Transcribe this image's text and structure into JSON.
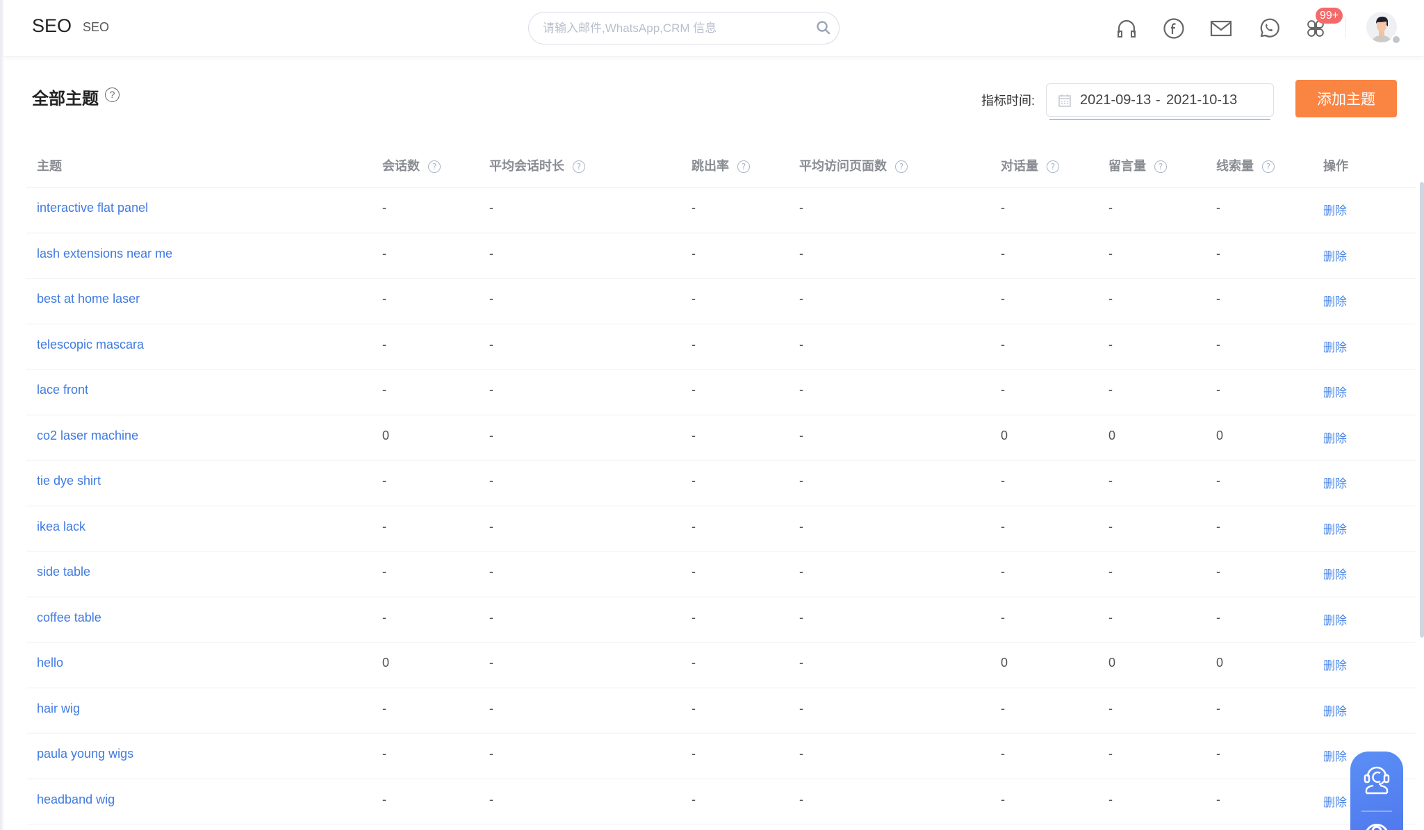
{
  "header": {
    "title": "SEO",
    "subtitle": "SEO",
    "search": {
      "placeholder": "请输入邮件,WhatsApp,CRM 信息",
      "value": ""
    },
    "icons": [
      "headset-icon",
      "facebook-icon",
      "mail-icon",
      "whatsapp-icon",
      "apps-icon"
    ],
    "notification_badge": "99+",
    "colors": {
      "badge": "#f46a6a"
    }
  },
  "page": {
    "title": "全部主题",
    "help_glyph": "?",
    "date_filter": {
      "label": "指标时间:",
      "start": "2021-09-13",
      "separator": "-",
      "end": "2021-10-13"
    },
    "add_button_label": "添加主题",
    "colors": {
      "accent": "#fa8542",
      "link": "#3f7ae0"
    }
  },
  "table": {
    "columns": [
      {
        "label": "主题",
        "help": false
      },
      {
        "label": "会话数",
        "help": true
      },
      {
        "label": "平均会话时长",
        "help": true
      },
      {
        "label": "跳出率",
        "help": true
      },
      {
        "label": "平均访问页面数",
        "help": true
      },
      {
        "label": "对话量",
        "help": true
      },
      {
        "label": "留言量",
        "help": true
      },
      {
        "label": "线索量",
        "help": true
      },
      {
        "label": "操作",
        "help": false
      }
    ],
    "help_glyph": "?",
    "action_label": "删除",
    "rows": [
      {
        "topic": "interactive flat panel",
        "sessions": "-",
        "avg_duration": "-",
        "bounce_rate": "-",
        "avg_pages": "-",
        "conversations": "-",
        "messages": "-",
        "leads": "-"
      },
      {
        "topic": "lash extensions near me",
        "sessions": "-",
        "avg_duration": "-",
        "bounce_rate": "-",
        "avg_pages": "-",
        "conversations": "-",
        "messages": "-",
        "leads": "-"
      },
      {
        "topic": "best at home laser",
        "sessions": "-",
        "avg_duration": "-",
        "bounce_rate": "-",
        "avg_pages": "-",
        "conversations": "-",
        "messages": "-",
        "leads": "-"
      },
      {
        "topic": "telescopic mascara",
        "sessions": "-",
        "avg_duration": "-",
        "bounce_rate": "-",
        "avg_pages": "-",
        "conversations": "-",
        "messages": "-",
        "leads": "-"
      },
      {
        "topic": "lace front",
        "sessions": "-",
        "avg_duration": "-",
        "bounce_rate": "-",
        "avg_pages": "-",
        "conversations": "-",
        "messages": "-",
        "leads": "-"
      },
      {
        "topic": "co2 laser machine",
        "sessions": "0",
        "avg_duration": "-",
        "bounce_rate": "-",
        "avg_pages": "-",
        "conversations": "0",
        "messages": "0",
        "leads": "0"
      },
      {
        "topic": "tie dye shirt",
        "sessions": "-",
        "avg_duration": "-",
        "bounce_rate": "-",
        "avg_pages": "-",
        "conversations": "-",
        "messages": "-",
        "leads": "-"
      },
      {
        "topic": "ikea lack",
        "sessions": "-",
        "avg_duration": "-",
        "bounce_rate": "-",
        "avg_pages": "-",
        "conversations": "-",
        "messages": "-",
        "leads": "-"
      },
      {
        "topic": "side table",
        "sessions": "-",
        "avg_duration": "-",
        "bounce_rate": "-",
        "avg_pages": "-",
        "conversations": "-",
        "messages": "-",
        "leads": "-"
      },
      {
        "topic": "coffee table",
        "sessions": "-",
        "avg_duration": "-",
        "bounce_rate": "-",
        "avg_pages": "-",
        "conversations": "-",
        "messages": "-",
        "leads": "-"
      },
      {
        "topic": "hello",
        "sessions": "0",
        "avg_duration": "-",
        "bounce_rate": "-",
        "avg_pages": "-",
        "conversations": "0",
        "messages": "0",
        "leads": "0"
      },
      {
        "topic": "hair wig",
        "sessions": "-",
        "avg_duration": "-",
        "bounce_rate": "-",
        "avg_pages": "-",
        "conversations": "-",
        "messages": "-",
        "leads": "-"
      },
      {
        "topic": "paula young wigs",
        "sessions": "-",
        "avg_duration": "-",
        "bounce_rate": "-",
        "avg_pages": "-",
        "conversations": "-",
        "messages": "-",
        "leads": "-"
      },
      {
        "topic": "headband wig",
        "sessions": "-",
        "avg_duration": "-",
        "bounce_rate": "-",
        "avg_pages": "-",
        "conversations": "-",
        "messages": "-",
        "leads": "-"
      }
    ]
  },
  "float_widget": {
    "items": [
      "customer-service-icon",
      "help-icon"
    ]
  }
}
